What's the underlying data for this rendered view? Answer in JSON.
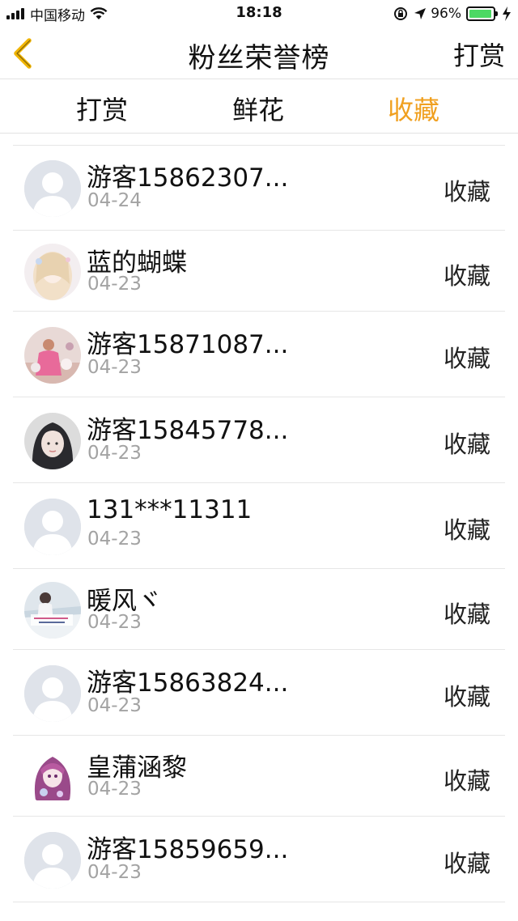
{
  "status_bar": {
    "carrier": "中国移动",
    "time": "18:18",
    "battery": "96%",
    "battery_level": 0.96
  },
  "nav": {
    "title": "粉丝荣誉榜",
    "right_action": "打赏"
  },
  "tabs": [
    {
      "label": "打赏",
      "active": false
    },
    {
      "label": "鲜花",
      "active": false
    },
    {
      "label": "收藏",
      "active": true
    }
  ],
  "accent_color": "#f0a020",
  "items": [
    {
      "name": "游客15862307...",
      "date": "04-24",
      "action": "收藏",
      "avatar": "default"
    },
    {
      "name": "蓝的蝴蝶",
      "date": "04-23",
      "action": "收藏",
      "avatar": "anime-girl"
    },
    {
      "name": "游客15871087...",
      "date": "04-23",
      "action": "收藏",
      "avatar": "photo-pink"
    },
    {
      "name": "游客15845778...",
      "date": "04-23",
      "action": "收藏",
      "avatar": "photo-girl"
    },
    {
      "name": "131***11311",
      "date": "04-23",
      "action": "收藏",
      "avatar": "default"
    },
    {
      "name": "暖风ヾ",
      "date": "04-23",
      "action": "收藏",
      "avatar": "photo-scene"
    },
    {
      "name": "游客15863824...",
      "date": "04-23",
      "action": "收藏",
      "avatar": "default"
    },
    {
      "name": "皇蒲涵黎",
      "date": "04-23",
      "action": "收藏",
      "avatar": "anime-purple"
    },
    {
      "name": "游客15859659...",
      "date": "04-23",
      "action": "收藏",
      "avatar": "default"
    }
  ]
}
